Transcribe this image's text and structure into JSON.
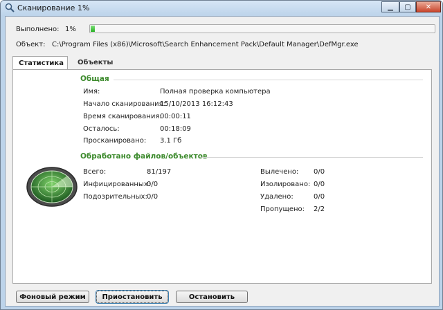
{
  "window": {
    "title": "Сканирование 1%",
    "controls": [
      "minimize",
      "maximize",
      "close"
    ]
  },
  "progress": {
    "label": "Выполнено:",
    "percent_text": "1%",
    "fraction": 0.01
  },
  "object": {
    "label": "Объект:",
    "path": "C:\\Program Files (x86)\\Microsoft\\Search Enhancement Pack\\Default Manager\\DefMgr.exe"
  },
  "tabs": [
    {
      "label": "Статистика",
      "active": true
    },
    {
      "label": "Объекты",
      "active": false
    }
  ],
  "general": {
    "title": "Общая",
    "rows": [
      {
        "key": "Имя:",
        "value": "Полная проверка компьютера"
      },
      {
        "key": "Начало сканирования:",
        "value": "15/10/2013 16:12:43"
      },
      {
        "key": "Время сканирования:",
        "value": "00:00:11"
      },
      {
        "key": "Осталось:",
        "value": "00:18:09"
      },
      {
        "key": "Просканировано:",
        "value": "3.1 Гб"
      }
    ]
  },
  "processed": {
    "title": "Обработано файлов/объектов",
    "left": [
      {
        "key": "Всего:",
        "value": "81/197"
      },
      {
        "key": "Инфицированных:",
        "value": "0/0"
      },
      {
        "key": "Подозрительных:",
        "value": "0/0"
      }
    ],
    "right": [
      {
        "key": "Вылечено:",
        "value": "0/0"
      },
      {
        "key": "Изолировано:",
        "value": "0/0"
      },
      {
        "key": "Удалено:",
        "value": "0/0"
      },
      {
        "key": "Пропущено:",
        "value": "2/2"
      }
    ]
  },
  "buttons": {
    "background": "Фоновый режим",
    "pause": "Приостановить",
    "stop": "Остановить"
  },
  "colors": {
    "section": "#3c8a2c",
    "progress": "#28b025"
  }
}
